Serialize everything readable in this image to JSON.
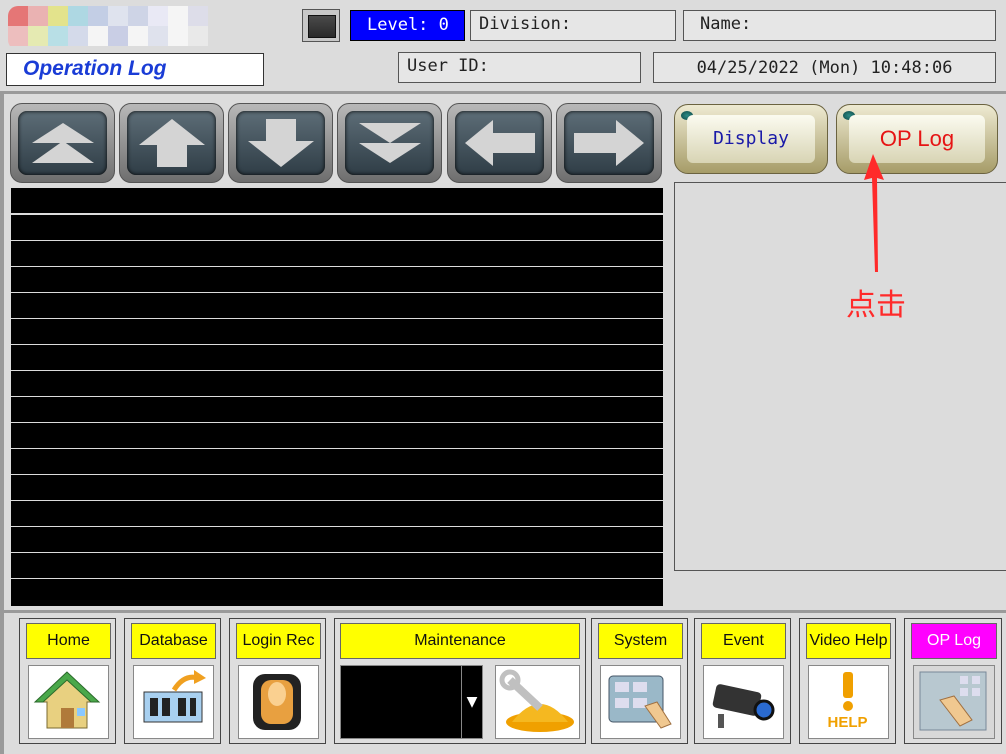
{
  "header": {
    "title": "Operation Log",
    "level": "Level: 0",
    "division_label": "Division:",
    "name_label": "Name:",
    "user_id_label": "User ID:",
    "datetime": "04/25/2022 (Mon) 10:48:06"
  },
  "view_buttons": {
    "display": "Display",
    "op_log": "OP Log"
  },
  "annotation": {
    "text": "点击",
    "color": "#ff2a2a"
  },
  "bottom_nav": {
    "home": "Home",
    "database": "Database",
    "login_rec": "Login Rec",
    "maintenance": "Maintenance",
    "system": "System",
    "event": "Event",
    "video_help": "Video Help",
    "op_log": "OP Log",
    "help_text": "HELP"
  },
  "colors": {
    "level_bg": "#0000ff",
    "label_yellow": "#ffff00",
    "active_magenta": "#ff00ff",
    "title_blue": "#1a3cd6"
  }
}
